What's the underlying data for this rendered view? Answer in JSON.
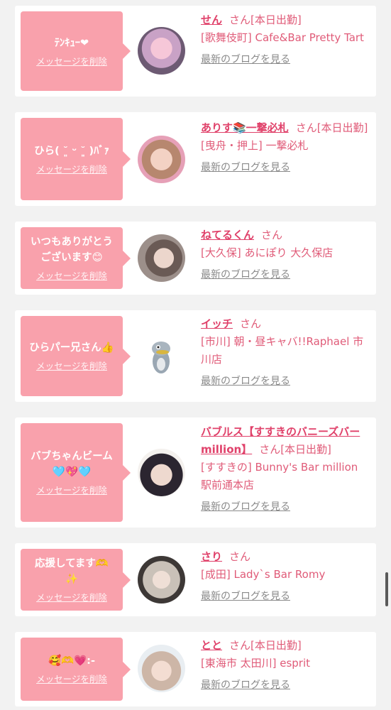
{
  "cards": [
    {
      "message": "ﾃﾝｷｭｰ❤",
      "name": "せん",
      "san": "さん",
      "suffix": "[本日出勤]",
      "shop": "[歌舞伎町] Cafe&Bar Pretty Tart",
      "blog": "最新のブログを見る",
      "delete": "メッセージを削除"
    },
    {
      "message": "ひら( ˘͈ ᵕ ˘͈ )ﾊﾞｧ",
      "name": "ありす📚一撃必札",
      "san": "さん",
      "suffix": "[本日出勤]",
      "shop": "[曳舟・押上] 一撃必札",
      "blog": "最新のブログを見る",
      "delete": "メッセージを削除"
    },
    {
      "message": "いつもありがとう\nございます😊",
      "name": "ねてるくん",
      "san": "さん",
      "suffix": "",
      "shop": "[大久保] あにぽり 大久保店",
      "blog": "最新のブログを見る",
      "delete": "メッセージを削除"
    },
    {
      "message": "ひらパー兄さん👍",
      "name": "イッチ",
      "san": "さん",
      "suffix": "",
      "shop": "[市川] 朝・昼キャバ!!Raphael 市川店",
      "blog": "最新のブログを見る",
      "delete": "メッセージを削除"
    },
    {
      "message": "バブちゃんビーム\n🩵💖🩵",
      "name": "バブルス【すすきのバニーズバーmillion】",
      "san": "さん",
      "suffix": "[本日出勤]",
      "shop": "[すすきの] Bunny's Bar million 駅前通本店",
      "blog": "最新のブログを見る",
      "delete": "メッセージを削除"
    },
    {
      "message": "応援してます🫶\n✨",
      "name": "さり",
      "san": "さん",
      "suffix": "",
      "shop": "[成田] Lady`s Bar Romy",
      "blog": "最新のブログを見る",
      "delete": "メッセージを削除"
    },
    {
      "message": "🥰🫶💗:-",
      "name": "とと",
      "san": "さん",
      "suffix": "[本日出勤]",
      "shop": "[東海市 太田川] esprit",
      "blog": "最新のブログを見る",
      "delete": "メッセージを削除"
    }
  ],
  "colors": {
    "bubble": "#f9a1ac",
    "name": "#e0416a",
    "text": "#e05b78",
    "link": "#8a8a8a"
  }
}
